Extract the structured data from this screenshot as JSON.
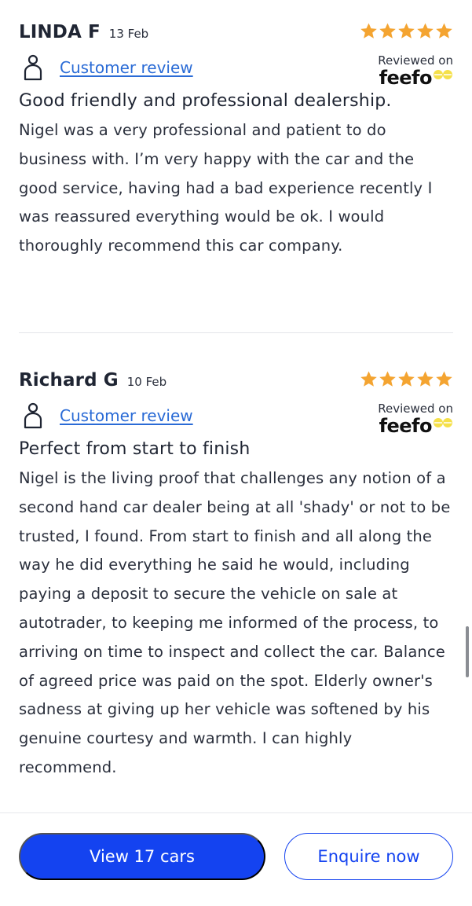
{
  "reviews": [
    {
      "name": "LINDA F",
      "date": "13 Feb",
      "review_type": "Customer review",
      "reviewed_on": "Reviewed on",
      "platform": "feefo",
      "rating": 5,
      "title": "Good friendly and professional dealership.",
      "body": "Nigel was a very professional and patient to do business with. I’m very happy with the car and the good service, having had a bad experience recently I was reassured everything would be ok. I would thoroughly recommend this car company."
    },
    {
      "name": "Richard G",
      "date": "10 Feb",
      "review_type": "Customer review",
      "reviewed_on": "Reviewed on",
      "platform": "feefo",
      "rating": 5,
      "title": "Perfect from start to finish",
      "body": "Nigel is the living proof that challenges any notion of a second hand car dealer being at all 'shady' or not to be trusted, I found. From start to finish and all along the way he did everything he said he would, including paying a deposit to secure the vehicle on sale at autotrader, to keeping me informed of the process, to arriving on time to inspect and collect the car. Balance of agreed price was paid on the spot. Elderly owner's sadness at giving up her vehicle was softened by his genuine courtesy and warmth. I can highly recommend."
    }
  ],
  "actions": {
    "view_cars_label": "View 17 cars",
    "enquire_label": "Enquire now"
  },
  "icons": {
    "star": "star-icon",
    "user": "user-icon",
    "feefo_eyes": "feefo-eyes-icon"
  },
  "colors": {
    "star": "#f4a431",
    "link": "#2a6bd6",
    "primary": "#1443f0",
    "feefo_eyes": "#f5e04a"
  }
}
